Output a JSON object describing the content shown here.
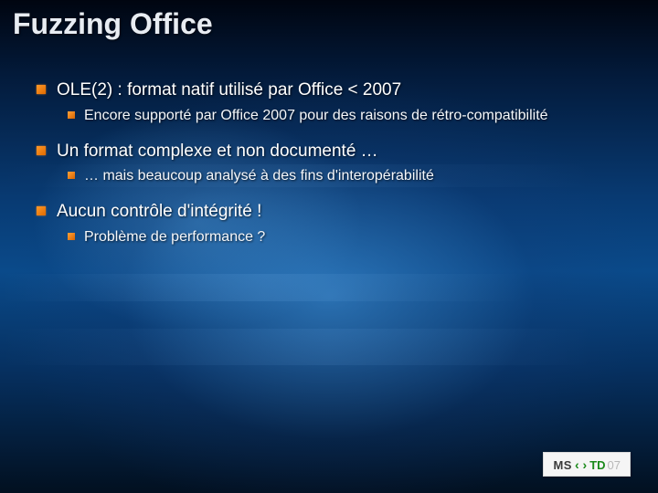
{
  "title": "Fuzzing Office",
  "bullets": [
    {
      "text": "OLE(2) : format natif utilisé par Office < 2007",
      "children": [
        {
          "text": "Encore supporté par Office 2007 pour des raisons de rétro-compatibilité"
        }
      ]
    },
    {
      "text": "Un format complexe et non documenté …",
      "children": [
        {
          "text": "… mais beaucoup analysé à des fins d'interopérabilité"
        }
      ]
    },
    {
      "text": "Aucun contrôle d'intégrité !",
      "children": [
        {
          "text": "Problème de performance ?"
        }
      ]
    }
  ],
  "footer": {
    "ms": "MS",
    "chev": "‹ ›",
    "td": "TD",
    "year": "07"
  }
}
